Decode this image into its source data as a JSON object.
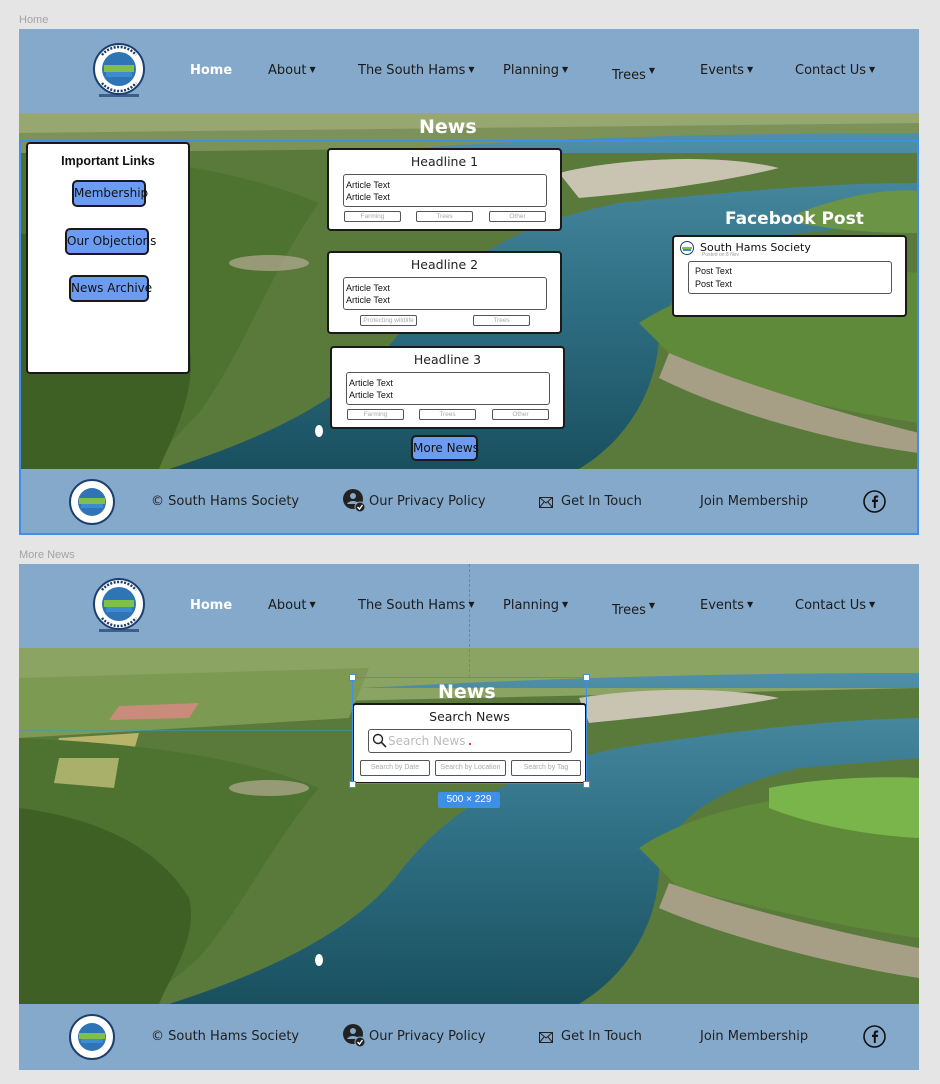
{
  "frames": {
    "home_label": "Home",
    "more_label": "More News"
  },
  "nav": {
    "home": "Home",
    "about": "About",
    "south_hams": "The South Hams",
    "planning": "Planning",
    "trees": "Trees",
    "events": "Events",
    "contact": "Contact Us"
  },
  "logo": {
    "text_top": "Protecting the South Hams",
    "text_bottom": "Working for the South Hams",
    "caption": "Est. since 1967 – 2023"
  },
  "home": {
    "news_title": "News",
    "important_links": {
      "title": "Important Links",
      "buttons": [
        "Membership",
        "Our Objections",
        "News Archive"
      ]
    },
    "articles": [
      {
        "headline": "Headline 1",
        "lines": [
          "Article Text",
          "Article Text"
        ],
        "tags": [
          "Farming",
          "Trees",
          "Other"
        ]
      },
      {
        "headline": "Headline 2",
        "lines": [
          "Article Text",
          "Article Text"
        ],
        "tags": [
          "Protecting wildlife",
          "Trees"
        ]
      },
      {
        "headline": "Headline 3",
        "lines": [
          "Article Text",
          "Article Text"
        ],
        "tags": [
          "Farming",
          "Trees",
          "Other"
        ]
      }
    ],
    "more_news": "More News",
    "facebook": {
      "title": "Facebook Post",
      "account": "South Hams Society",
      "posted": "Posted on 8 Nov",
      "lines": [
        "Post Text",
        "Post Text"
      ]
    }
  },
  "more": {
    "news_title": "News",
    "search_title": "Search News",
    "search_placeholder": "Search News",
    "filters": [
      "Search by Date",
      "Search by Location",
      "Search by Tag"
    ],
    "dimensions": "500 × 229"
  },
  "footer": {
    "copyright": "© South Hams Society",
    "privacy": "Our Privacy Policy",
    "contact": "Get In Touch",
    "join": "Join Membership"
  },
  "colors": {
    "header": "#85a9cb",
    "button": "#6c9cf2",
    "selection": "#3d8fe8"
  }
}
